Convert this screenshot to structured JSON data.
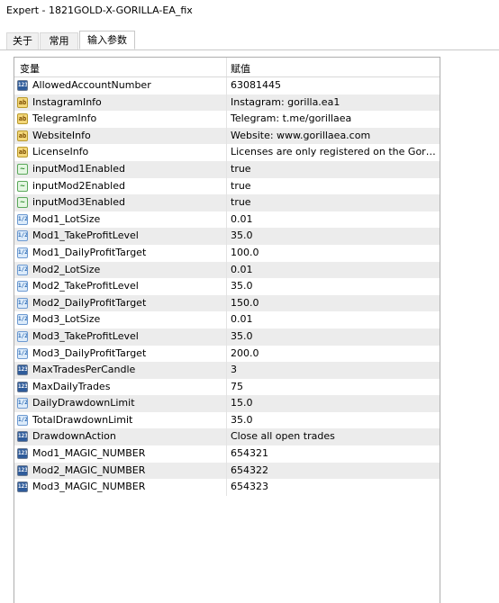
{
  "window": {
    "title": "Expert - 1821GOLD-X-GORILLA-EA_fix"
  },
  "tabs": [
    {
      "label": "关于"
    },
    {
      "label": "常用"
    },
    {
      "label": "输入参数"
    }
  ],
  "grid": {
    "col_variable": "变量",
    "col_value": "赋值",
    "rows": [
      {
        "type": "int",
        "icon": "123",
        "name": "AllowedAccountNumber",
        "value": "63081445"
      },
      {
        "type": "str",
        "icon": "ab",
        "name": "InstagramInfo",
        "value": "Instagram: gorilla.ea1"
      },
      {
        "type": "str",
        "icon": "ab",
        "name": "TelegramInfo",
        "value": "Telegram: t.me/gorillaea"
      },
      {
        "type": "str",
        "icon": "ab",
        "name": "WebsiteInfo",
        "value": "Website: www.gorillaea.com"
      },
      {
        "type": "str",
        "icon": "ab",
        "name": "LicenseInfo",
        "value": "Licenses are only registered on the Gorilla ..."
      },
      {
        "type": "bool",
        "icon": "~",
        "name": "inputMod1Enabled",
        "value": "true"
      },
      {
        "type": "bool",
        "icon": "~",
        "name": "inputMod2Enabled",
        "value": "true"
      },
      {
        "type": "bool",
        "icon": "~",
        "name": "inputMod3Enabled",
        "value": "true"
      },
      {
        "type": "dbl",
        "icon": "1/2",
        "name": "Mod1_LotSize",
        "value": "0.01"
      },
      {
        "type": "dbl",
        "icon": "1/2",
        "name": "Mod1_TakeProfitLevel",
        "value": "35.0"
      },
      {
        "type": "dbl",
        "icon": "1/2",
        "name": "Mod1_DailyProfitTarget",
        "value": "100.0"
      },
      {
        "type": "dbl",
        "icon": "1/2",
        "name": "Mod2_LotSize",
        "value": "0.01"
      },
      {
        "type": "dbl",
        "icon": "1/2",
        "name": "Mod2_TakeProfitLevel",
        "value": "35.0"
      },
      {
        "type": "dbl",
        "icon": "1/2",
        "name": "Mod2_DailyProfitTarget",
        "value": "150.0"
      },
      {
        "type": "dbl",
        "icon": "1/2",
        "name": "Mod3_LotSize",
        "value": "0.01"
      },
      {
        "type": "dbl",
        "icon": "1/2",
        "name": "Mod3_TakeProfitLevel",
        "value": "35.0"
      },
      {
        "type": "dbl",
        "icon": "1/2",
        "name": "Mod3_DailyProfitTarget",
        "value": "200.0"
      },
      {
        "type": "int",
        "icon": "123",
        "name": "MaxTradesPerCandle",
        "value": "3"
      },
      {
        "type": "int",
        "icon": "123",
        "name": "MaxDailyTrades",
        "value": "75"
      },
      {
        "type": "dbl",
        "icon": "1/2",
        "name": "DailyDrawdownLimit",
        "value": "15.0"
      },
      {
        "type": "dbl",
        "icon": "1/2",
        "name": "TotalDrawdownLimit",
        "value": "35.0"
      },
      {
        "type": "int",
        "icon": "123",
        "name": "DrawdownAction",
        "value": "Close all open trades"
      },
      {
        "type": "int",
        "icon": "123",
        "name": "Mod1_MAGIC_NUMBER",
        "value": "654321"
      },
      {
        "type": "int",
        "icon": "123",
        "name": "Mod2_MAGIC_NUMBER",
        "value": "654322"
      },
      {
        "type": "int",
        "icon": "123",
        "name": "Mod3_MAGIC_NUMBER",
        "value": "654323"
      }
    ]
  }
}
